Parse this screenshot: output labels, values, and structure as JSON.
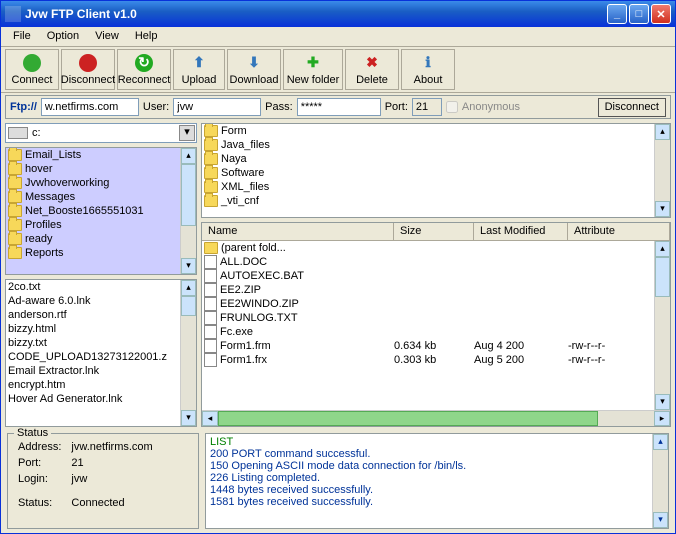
{
  "window": {
    "title": "Jvw FTP Client v1.0"
  },
  "menu": {
    "file": "File",
    "option": "Option",
    "view": "View",
    "help": "Help"
  },
  "toolbar": {
    "connect": "Connect",
    "disconnect": "Disconnect",
    "reconnect": "Reconnect",
    "upload": "Upload",
    "download": "Download",
    "newfolder": "New folder",
    "delete": "Delete",
    "about": "About"
  },
  "conn": {
    "ftp": "Ftp://",
    "host": "w.netfirms.com",
    "user_lbl": "User:",
    "user": "jvw",
    "pass_lbl": "Pass:",
    "pass": "*****",
    "port_lbl": "Port:",
    "port": "21",
    "anon": "Anonymous",
    "disconnect_btn": "Disconnect"
  },
  "drive": "c:",
  "local_folders": [
    "Email_Lists",
    "hover",
    "Jvwhoverworking",
    "Messages",
    "Net_Booste1665551031",
    "Profiles",
    "ready",
    "Reports"
  ],
  "local_files": [
    "2co.txt",
    "Ad-aware 6.0.lnk",
    "anderson.rtf",
    "bizzy.html",
    "bizzy.txt",
    "CODE_UPLOAD13273122001.z",
    "Email Extractor.lnk",
    "encrypt.htm",
    "Hover Ad Generator.lnk"
  ],
  "remote_folders": [
    "Form",
    "Java_files",
    "Naya",
    "Software",
    "XML_files",
    "_vti_cnf"
  ],
  "remote_cols": {
    "name": "Name",
    "size": "Size",
    "modified": "Last Modified",
    "attr": "Attribute"
  },
  "remote_files": [
    {
      "name": "(parent fold...",
      "size": "",
      "mod": "",
      "attr": ""
    },
    {
      "name": "ALL.DOC",
      "size": "",
      "mod": "",
      "attr": ""
    },
    {
      "name": "AUTOEXEC.BAT",
      "size": "",
      "mod": "",
      "attr": ""
    },
    {
      "name": "EE2.ZIP",
      "size": "",
      "mod": "",
      "attr": ""
    },
    {
      "name": "EE2WINDO.ZIP",
      "size": "",
      "mod": "",
      "attr": ""
    },
    {
      "name": "FRUNLOG.TXT",
      "size": "",
      "mod": "",
      "attr": ""
    },
    {
      "name": "Fc.exe",
      "size": "",
      "mod": "",
      "attr": ""
    },
    {
      "name": "Form1.frm",
      "size": "0.634 kb",
      "mod": "Aug 4  200",
      "attr": "-rw-r--r-"
    },
    {
      "name": "Form1.frx",
      "size": "0.303 kb",
      "mod": "Aug 5  200",
      "attr": "-rw-r--r-"
    }
  ],
  "status": {
    "legend": "Status",
    "addr_lbl": "Address:",
    "addr": "jvw.netfirms.com",
    "port_lbl": "Port:",
    "port": "21",
    "login_lbl": "Login:",
    "login": "jvw",
    "status_lbl": "Status:",
    "status": "Connected"
  },
  "log": {
    "l0": "LIST",
    "l1": "200 PORT command successful.",
    "l2": "150 Opening ASCII mode data connection for /bin/ls.",
    "l3": "226 Listing completed.",
    "l4": "1448 bytes received successfully.",
    "l5": "1581 bytes received successfully."
  }
}
